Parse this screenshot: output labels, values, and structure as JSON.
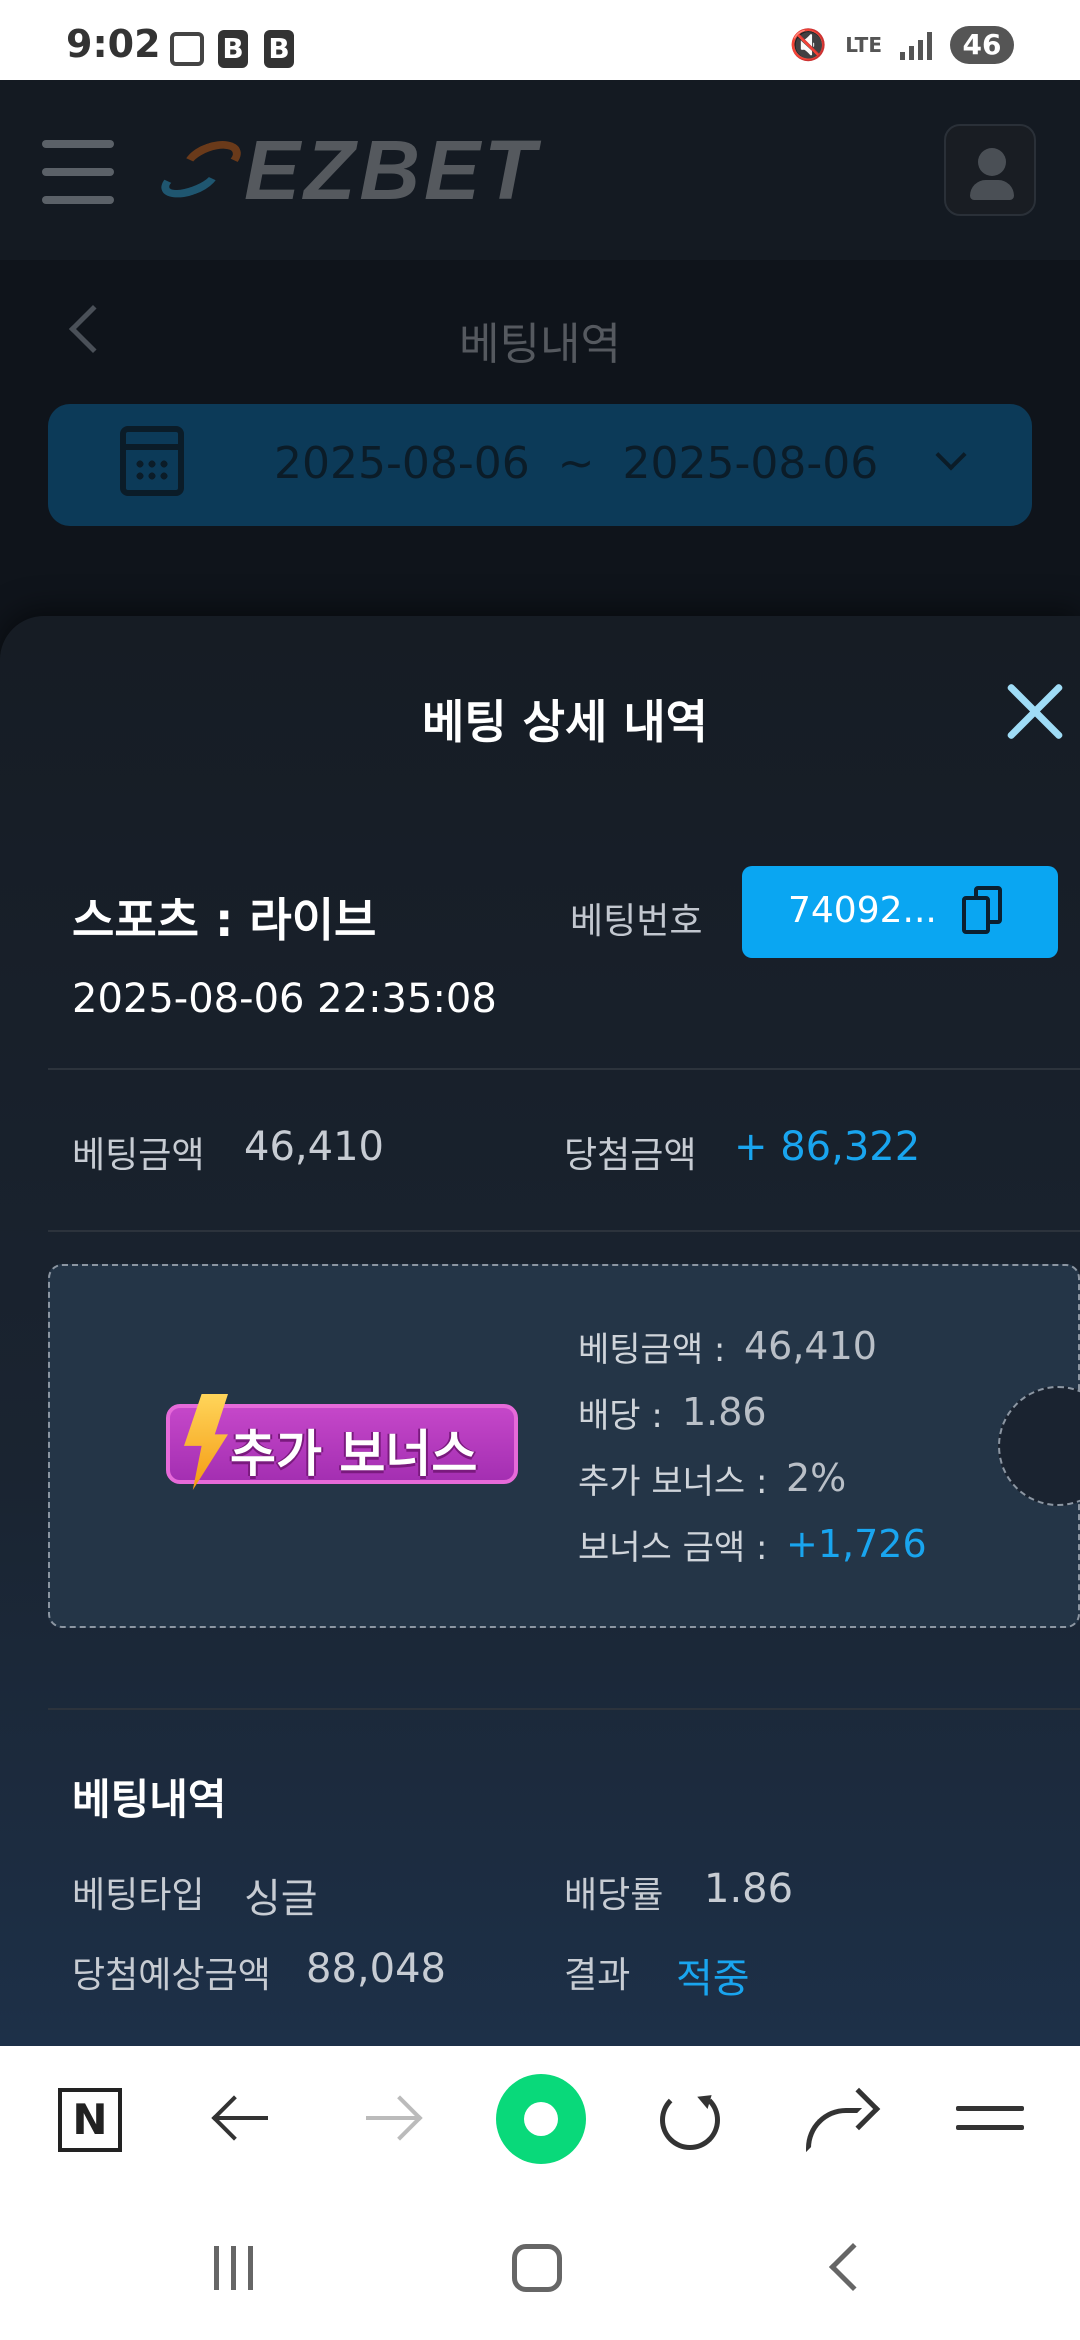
{
  "status_bar": {
    "time": "9:02",
    "battery": "46",
    "network": "LTE",
    "icons": [
      "screenshot-icon",
      "b-app-icon",
      "b-app-icon",
      "mute-icon",
      "signal-icon",
      "battery-icon"
    ]
  },
  "app_header": {
    "logo_text": "EZBET",
    "menu_icon": "hamburger-icon",
    "user_icon": "user-icon"
  },
  "page": {
    "title": "베팅내역",
    "date_range": "2025-08-06  ~  2025-08-06"
  },
  "sheet": {
    "title": "베팅 상세 내역",
    "game_type": "스포츠 : 라이브",
    "bet_time": "2025-08-06 22:35:08",
    "bet_no_label": "베팅번호",
    "bet_no_value": "74092...",
    "bet_amount_label": "베팅금액",
    "bet_amount_value": "46,410",
    "win_amount_label": "당첨금액",
    "win_amount_value": "+ 86,322",
    "bonus": {
      "badge_text": "추가 보너스",
      "bet_amount_label": "베팅금액 :",
      "bet_amount_value": "46,410",
      "odds_label": "배당 :",
      "odds_value": "1.86",
      "extra_label": "추가 보너스 :",
      "extra_value": "2%",
      "bonus_amount_label": "보너스 금액 :",
      "bonus_amount_value": "+1,726"
    },
    "history": {
      "title": "베팅내역",
      "bet_type_label": "베팅타입",
      "bet_type_value": "싱글",
      "odds_rate_label": "배당률",
      "odds_rate_value": "1.86",
      "expected_label": "당첨예상금액",
      "expected_value": "88,048",
      "result_label": "결과",
      "result_value": "적중"
    }
  },
  "browser_bar": {
    "n_button": "N",
    "icons": [
      "n-icon",
      "back-arrow-icon",
      "forward-arrow-icon",
      "home-dot-icon",
      "reload-icon",
      "share-icon",
      "menu-icon"
    ]
  },
  "colors": {
    "accent_blue": "#0aa6f2",
    "sheet_bg": "#161c24",
    "bonus_box": "#243547",
    "positive_text": "#19a5ef"
  }
}
